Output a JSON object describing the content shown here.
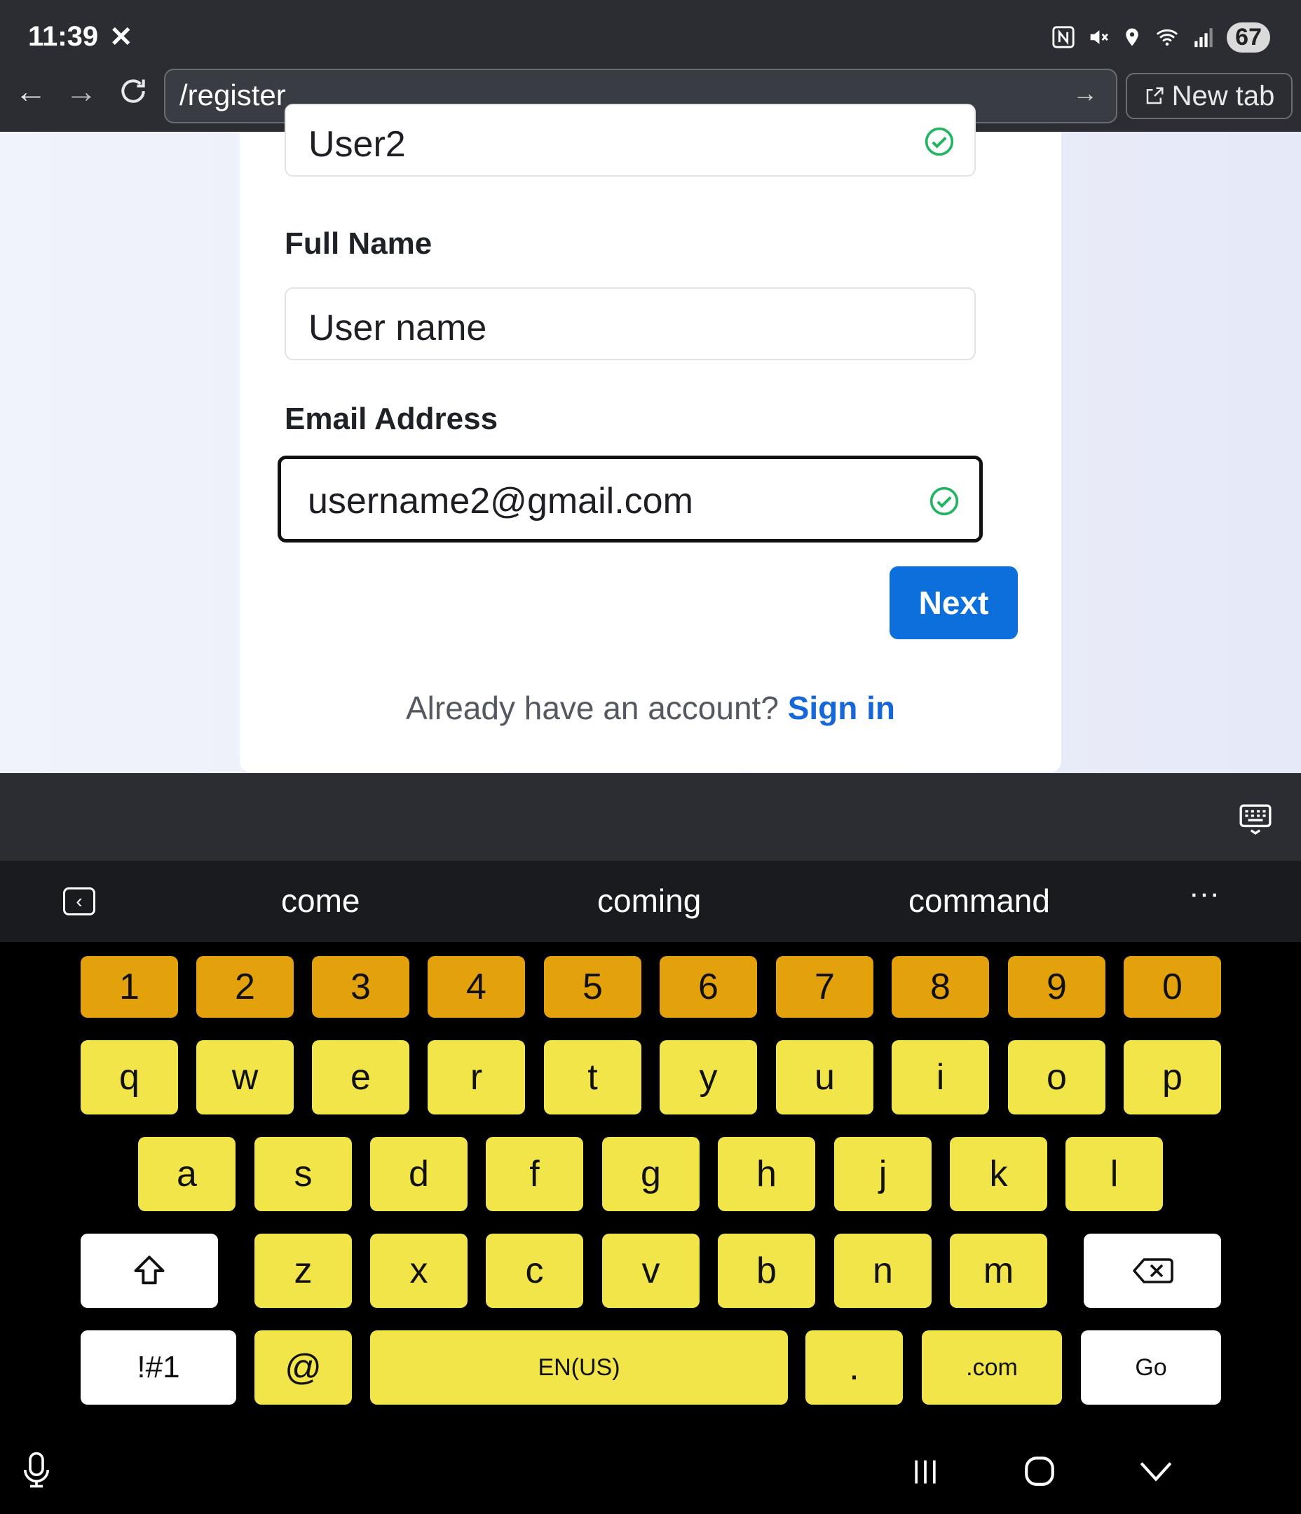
{
  "status_bar": {
    "time": "11:39",
    "x_glyph": "✕",
    "icons": [
      "nfc-icon",
      "mute-icon",
      "location-icon",
      "wifi-icon",
      "signal-icon"
    ],
    "battery": "67"
  },
  "browser": {
    "url": "/register",
    "new_tab_label": "New tab"
  },
  "form": {
    "username_value": "User2",
    "full_name_label": "Full Name",
    "full_name_value": "User name",
    "email_label": "Email Address",
    "email_value": "username2@gmail.com",
    "next_label": "Next",
    "already_text": "Already have an account?",
    "sign_in_label": "Sign in"
  },
  "keyboard": {
    "suggestions": [
      "come",
      "coming",
      "command"
    ],
    "number_row": [
      "1",
      "2",
      "3",
      "4",
      "5",
      "6",
      "7",
      "8",
      "9",
      "0"
    ],
    "row1": [
      "q",
      "w",
      "e",
      "r",
      "t",
      "y",
      "u",
      "i",
      "o",
      "p"
    ],
    "row2": [
      "a",
      "s",
      "d",
      "f",
      "g",
      "h",
      "j",
      "k",
      "l"
    ],
    "row3": [
      "z",
      "x",
      "c",
      "v",
      "b",
      "n",
      "m"
    ],
    "symbols_label": "!#1",
    "at_label": "@",
    "space_label": "EN(US)",
    "period_label": ".",
    "dotcom_label": ".com",
    "go_label": "Go"
  },
  "colors": {
    "number_keys": "#e3a10b",
    "letter_keys": "#f1e54a",
    "primary_button": "#0d6fdc",
    "link": "#1767d8",
    "check": "#22b561"
  }
}
